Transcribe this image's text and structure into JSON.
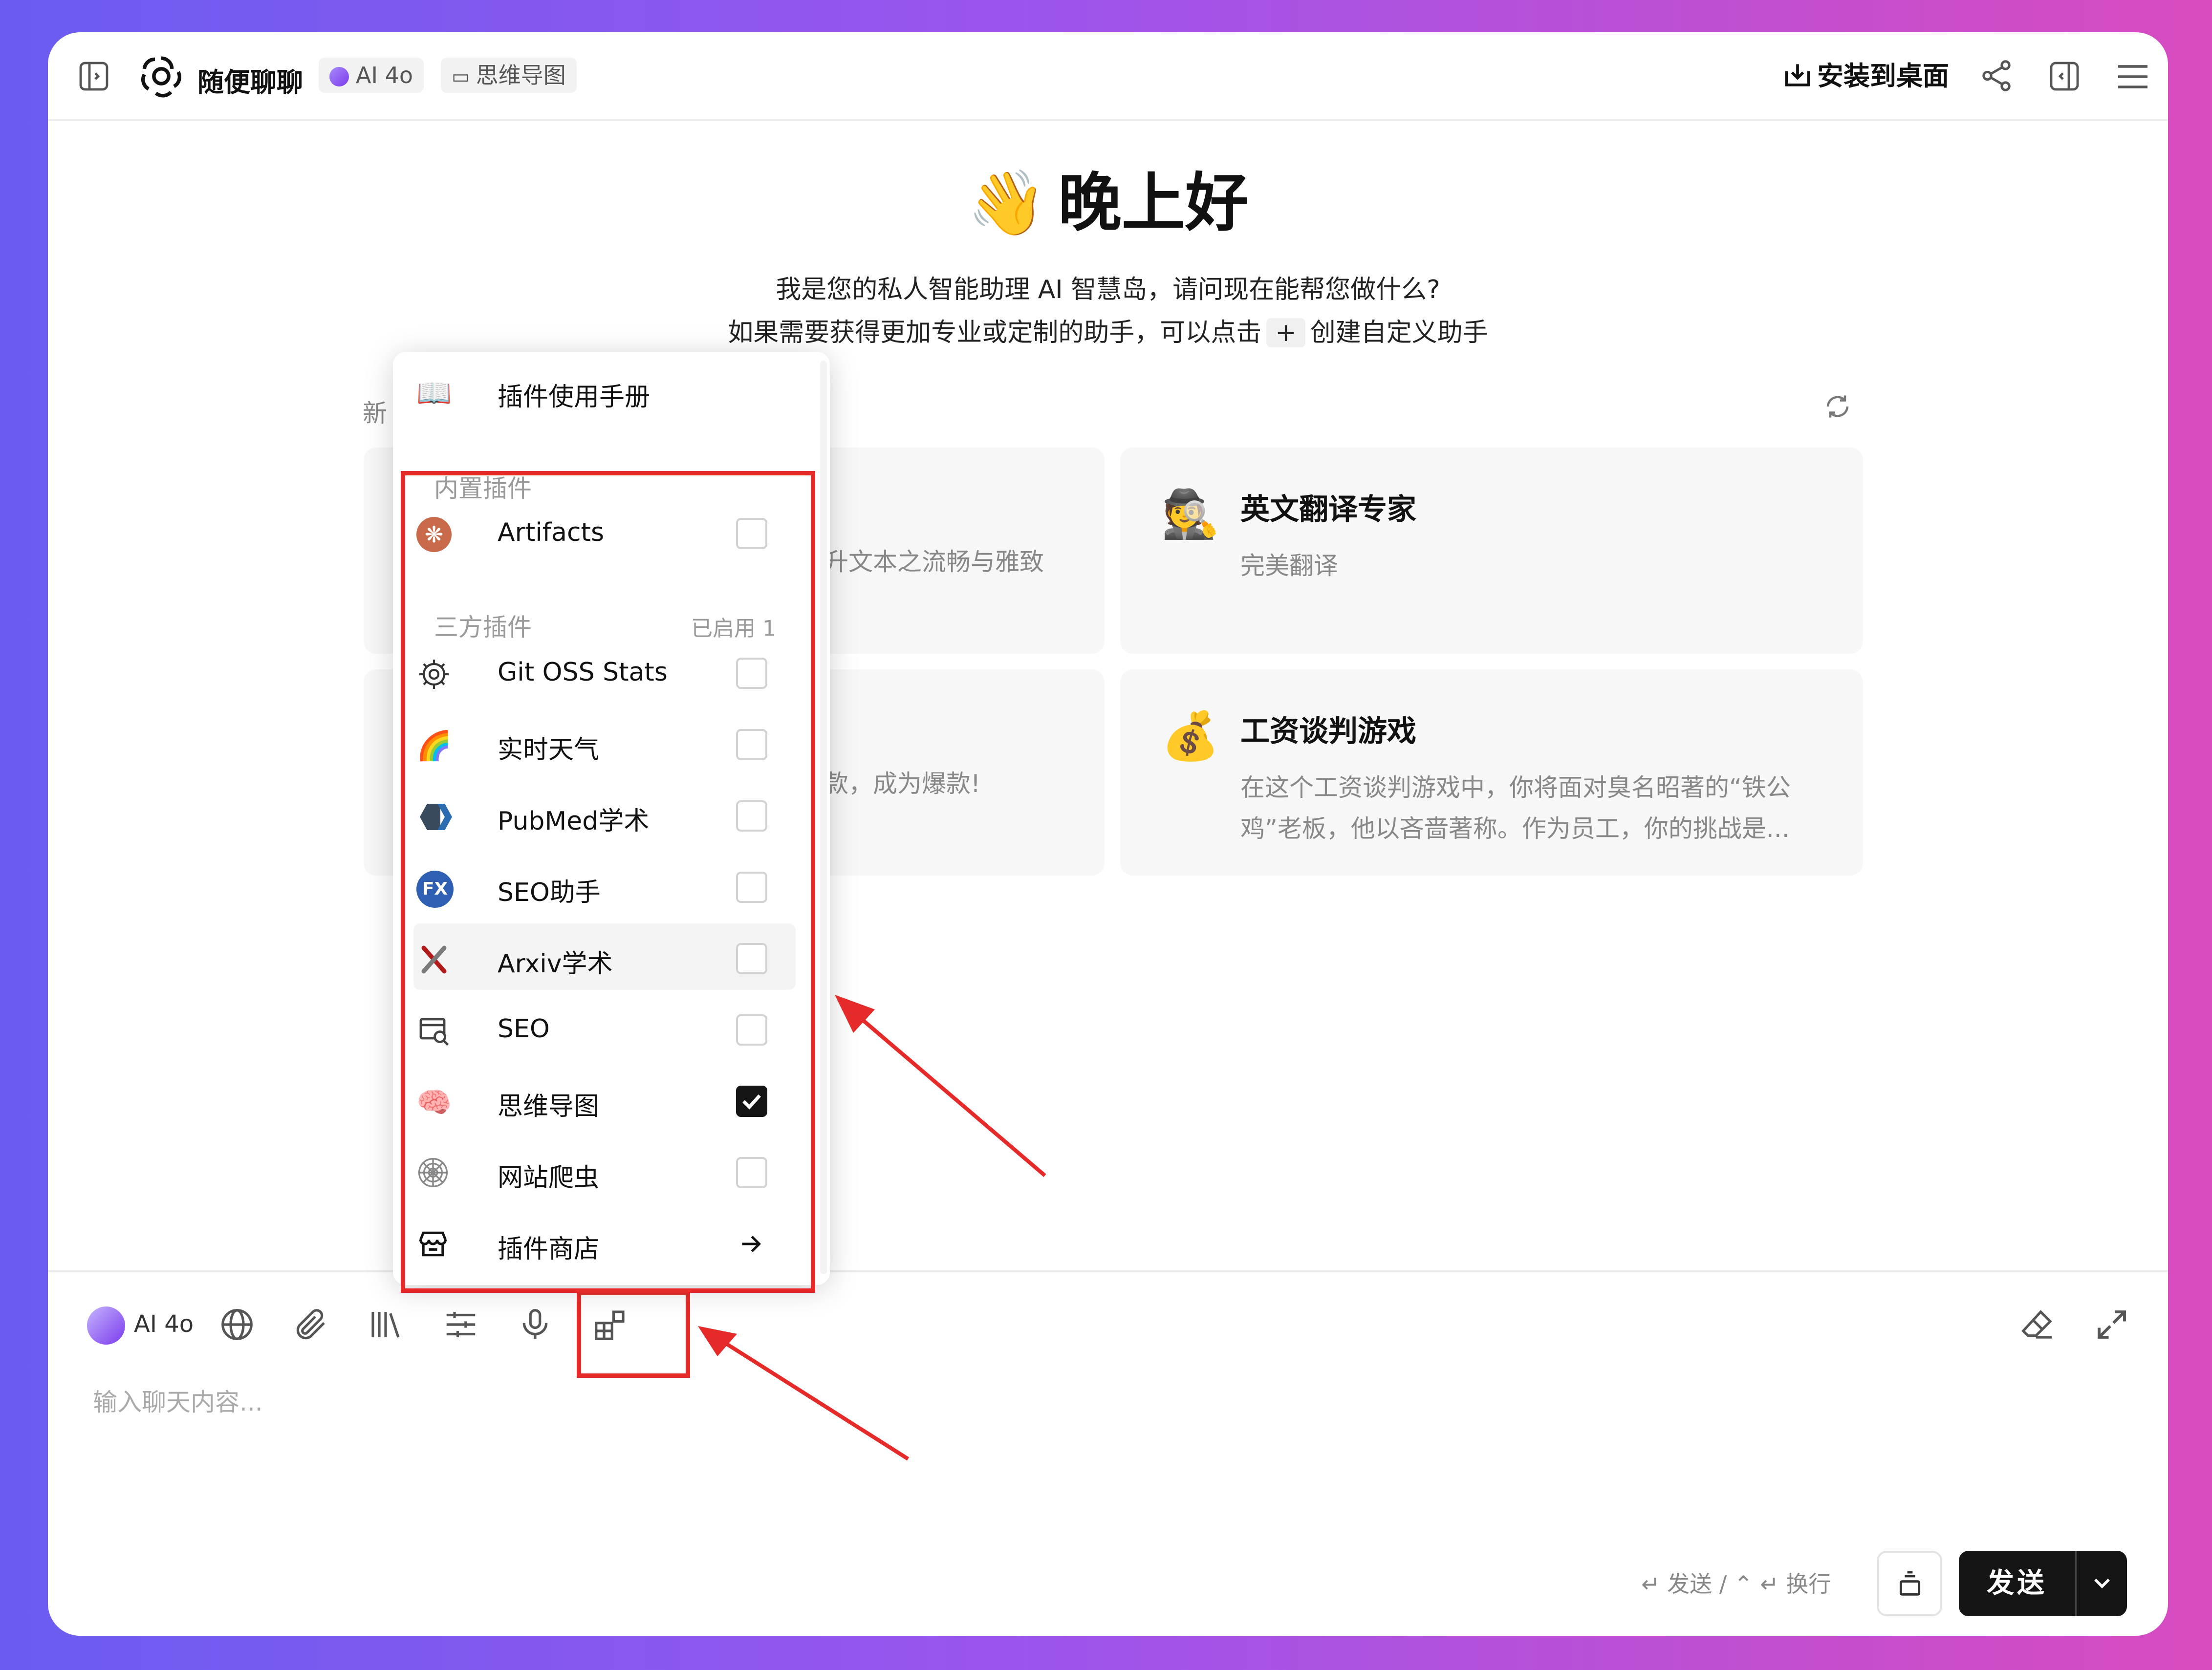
{
  "header": {
    "app_title": "随便聊聊",
    "model_chip": "AI 4o",
    "plugin_chip": "思维导图",
    "install_label": "安装到桌面"
  },
  "main": {
    "greeting": "晚上好",
    "greeting_emoji": "👋",
    "intro_line1": "我是您的私人智能助理 AI 智慧岛，请问现在能帮您做什么?",
    "intro_line2_before": "如果需要获得更加专业或定制的助手，可以点击",
    "intro_key": "+",
    "intro_line2_after": "创建自定义助手",
    "section_label": "新",
    "cards": [
      {
        "emoji": "🕵️",
        "title": "英文翻译专家",
        "desc": "完美翻译"
      },
      {
        "emoji": "💰",
        "title": "工资谈判游戏",
        "desc": "在这个工资谈判游戏中，你将面对臭名昭著的“铁公鸡”老板，他以吝啬著称。作为员工，你的挑战是..."
      }
    ],
    "clipped_texts": [
      "提升文本之流畅与雅致",
      "爆款，成为爆款!"
    ]
  },
  "plugin_menu": {
    "manual_label": "插件使用手册",
    "builtin_group": "内置插件",
    "builtin": [
      {
        "icon": "artifacts-icon",
        "label": "Artifacts",
        "checked": false
      }
    ],
    "third_party_group": "三方插件",
    "enabled_count": "已启用 1",
    "third_party": [
      {
        "icon": "git-oss-stats-icon",
        "label": "Git OSS Stats",
        "checked": false
      },
      {
        "icon": "rainbow-icon",
        "label": "实时天气",
        "checked": false
      },
      {
        "icon": "pubmed-icon",
        "label": "PubMed学术",
        "checked": false
      },
      {
        "icon": "fx-icon",
        "label": "SEO助手",
        "checked": false
      },
      {
        "icon": "arxiv-icon",
        "label": "Arxiv学术",
        "checked": false
      },
      {
        "icon": "seo-icon",
        "label": "SEO",
        "checked": false
      },
      {
        "icon": "brain-icon",
        "label": "思维导图",
        "checked": true
      },
      {
        "icon": "spider-web-icon",
        "label": "网站爬虫",
        "checked": false
      }
    ],
    "store_label": "插件商店"
  },
  "input": {
    "model_label": "AI 4o",
    "placeholder": "输入聊天内容...",
    "hint": "↵ 发送 / ⌃ ↵ 换行",
    "send_label": "发送"
  },
  "colors": {
    "accent": "#141414",
    "annotation_red": "#e52a2a",
    "purple": "#7c3aed"
  }
}
